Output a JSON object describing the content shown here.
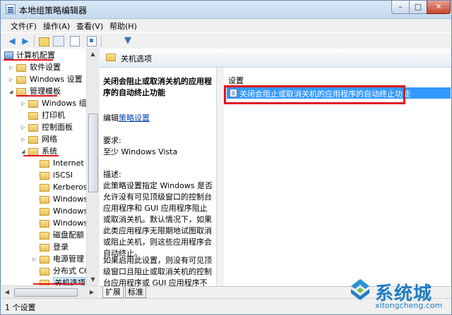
{
  "window": {
    "title": "本地组策略编辑器",
    "controls": {
      "minimize": "–",
      "maximize": "□",
      "close": "✕"
    }
  },
  "menu": [
    "文件(F)",
    "操作(A)",
    "查看(V)",
    "帮助(H)"
  ],
  "toolbar": {
    "icons": [
      "back-arrow-icon",
      "forward-arrow-icon",
      "up-folder-icon",
      "show-hide-tree-icon",
      "export-list-icon",
      "help-icon",
      "filter-icon"
    ]
  },
  "tree": {
    "root": "计算机配置",
    "items": [
      "软件设置",
      "Windows 设置",
      "管理模板",
      "Windows 组件",
      "打印机",
      "控制面板",
      "网络",
      "系统",
      "Internet 通",
      "iSCSI",
      "Kerberos",
      "Windows",
      "Windows",
      "Windows",
      "磁盘配额",
      "登录",
      "电源管理",
      "分布式 CO",
      "关机选项"
    ]
  },
  "right_pane": {
    "header": "关机选项",
    "description": {
      "title": "关闭会阻止或取消关机的应用程序的自动终止功能",
      "edit_prefix": "编辑",
      "edit_link": "策略设置",
      "requirements_label": "要求:",
      "requirements_value": "至少 Windows Vista",
      "desc_label": "描述:",
      "desc_text": "此策略设置指定 Windows 是否允许没有可见顶级窗口的控制台应用程序和 GUI 应用程序阻止或取消关机。默认情况下，如果此类应用程序无限期地试图取消或阻止关机，则这些应用程序会自动终止。",
      "desc_text2": "如果启用此设置，则没有可见顶级窗口且阻止或取消关机的控制台应用程序或 GUI 应用程序不会在关"
    },
    "list": {
      "column_header": "设置",
      "rows": [
        "关闭会阻止或取消关机的应用程序的自动终止功能"
      ]
    },
    "tabs": [
      "扩展",
      "标准"
    ]
  },
  "status_bar": {
    "text": "1 个设置"
  },
  "watermark": {
    "brand": "系统城",
    "url": "xitongcheng.com"
  },
  "colors": {
    "selection": "#3399ff",
    "annotation_red": "#e0141e",
    "watermark_blue": "#1f7dc4"
  }
}
